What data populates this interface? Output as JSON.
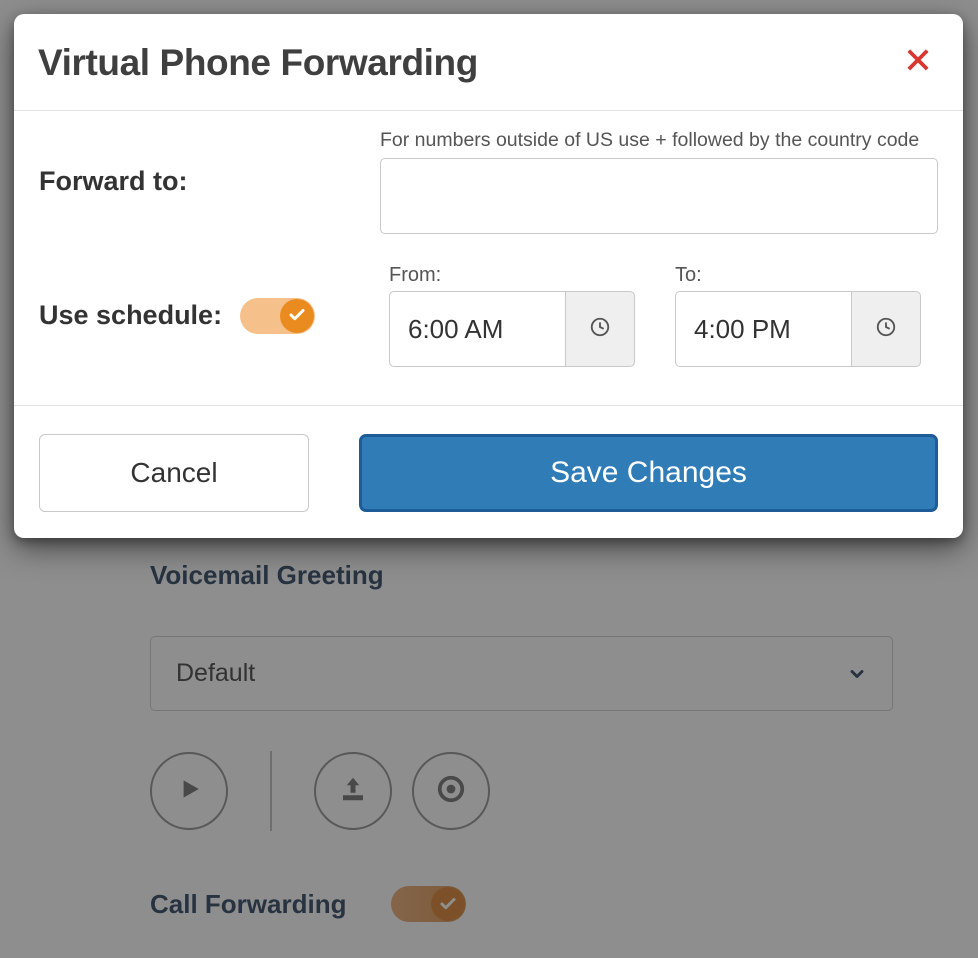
{
  "modal": {
    "title": "Virtual Phone Forwarding",
    "forward_to_label": "Forward to:",
    "forward_help": "For numbers outside of US use + followed by the country code",
    "forward_value": "",
    "use_schedule_label": "Use schedule:",
    "use_schedule_on": true,
    "from_label": "From:",
    "from_value": "6:00 AM",
    "to_label": "To:",
    "to_value": "4:00 PM",
    "cancel_label": "Cancel",
    "save_label": "Save Changes"
  },
  "background": {
    "greeting_title": "Voicemail Greeting",
    "greeting_selected": "Default",
    "call_forwarding_label": "Call Forwarding",
    "call_forwarding_on": true
  }
}
